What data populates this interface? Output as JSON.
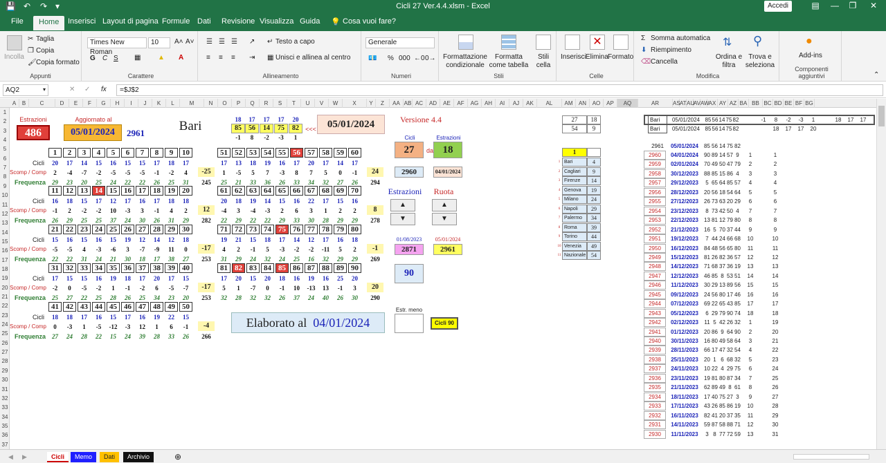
{
  "window": {
    "title": "Cicli 27 Ver.4.4.xlsm  -  Excel",
    "signin": "Accedi"
  },
  "menu_tabs": [
    "File",
    "Home",
    "Inserisci",
    "Layout di pagina",
    "Formule",
    "Dati",
    "Revisione",
    "Visualizza",
    "Guida",
    "Cosa vuoi fare?"
  ],
  "ribbon": {
    "clipboard": {
      "paste": "Incolla",
      "cut": "Taglia",
      "copy": "Copia",
      "format_painter": "Copia formato",
      "label": "Appunti"
    },
    "font": {
      "name": "Times New Roman",
      "size": "10",
      "label": "Carattere",
      "bold": "G",
      "italic": "C",
      "underline": "S"
    },
    "alignment": {
      "wrap": "Testo a capo",
      "merge": "Unisci e allinea al centro",
      "label": "Allineamento"
    },
    "number": {
      "format": "Generale",
      "label": "Numeri"
    },
    "styles": {
      "cond": "Formattazione condizionale",
      "table": "Formatta come tabella",
      "cell": "Stili cella",
      "label": "Stili"
    },
    "cells": {
      "insert": "Inserisci",
      "delete": "Elimina",
      "format": "Formato",
      "label": "Celle"
    },
    "editing": {
      "autosum": "Somma automatica",
      "fill": "Riempimento",
      "clear": "Cancella",
      "sort": "Ordina e filtra",
      "find": "Trova e seleziona",
      "label": "Modifica"
    },
    "addins": {
      "addins": "Add-ins",
      "label": "Componenti aggiuntivi"
    }
  },
  "formula_bar": {
    "name_box": "AQ2",
    "formula": "=$J$2"
  },
  "columns": [
    "A",
    "B",
    "C",
    "D",
    "E",
    "F",
    "G",
    "H",
    "I",
    "J",
    "K",
    "L",
    "M",
    "N",
    "O",
    "P",
    "Q",
    "R",
    "S",
    "T",
    "U",
    "V",
    "W",
    "X",
    "Y",
    "Z",
    "AA",
    "AB",
    "AC",
    "AD",
    "AE",
    "AF",
    "AG",
    "AH",
    "AI",
    "AJ",
    "AK",
    "AL",
    "AM",
    "AN",
    "AO",
    "AP",
    "AQ",
    "AR",
    "AS",
    "AT",
    "AU",
    "AV",
    "AW",
    "AX",
    "AY",
    "AZ",
    "BA",
    "BB",
    "BC",
    "BD",
    "BE",
    "BF",
    "BG"
  ],
  "rows": [
    1,
    2,
    3,
    4,
    5,
    6,
    7,
    8,
    9,
    10,
    11,
    12,
    13,
    14,
    15,
    16,
    17,
    18,
    19,
    20,
    21,
    22,
    23,
    24,
    25,
    26,
    27,
    28,
    29,
    30,
    31,
    32,
    33,
    34,
    35,
    36,
    37
  ],
  "header": {
    "estrazioni_label": "Estrazioni",
    "estrazioni_value": "486",
    "aggiornato_label": "Aggiornato al",
    "aggiornato_date": "05/01/2024",
    "aggiornato_num": "2961",
    "ruota": "Bari",
    "top_cycles": [
      "18",
      "17",
      "17",
      "17",
      "20"
    ],
    "top_numbers": [
      "85",
      "56",
      "14",
      "75",
      "82"
    ],
    "top_arrow": "<<<",
    "top_deltas": [
      "-1",
      "8",
      "-2",
      "-3",
      "1"
    ],
    "top_date": "05/01/2024",
    "version": "Versione 4.4"
  },
  "row_labels": {
    "cicli": "Cicli",
    "scomp": "Scomp / Comp",
    "freq": "Frequenza"
  },
  "blocks_left": [
    {
      "numbers": [
        "1",
        "2",
        "3",
        "4",
        "5",
        "6",
        "7",
        "8",
        "9",
        "10"
      ],
      "red": [],
      "cicli": [
        "20",
        "17",
        "14",
        "15",
        "16",
        "15",
        "15",
        "17",
        "18",
        "17"
      ],
      "scomp": [
        "2",
        "-4",
        "-7",
        "-2",
        "-5",
        "-5",
        "-5",
        "-1",
        "-2",
        "4"
      ],
      "freq": [
        "29",
        "23",
        "20",
        "25",
        "24",
        "22",
        "22",
        "26",
        "25",
        "31"
      ],
      "box": "-25",
      "total": "245"
    },
    {
      "numbers": [
        "11",
        "12",
        "13",
        "14",
        "15",
        "16",
        "17",
        "18",
        "19",
        "20"
      ],
      "red": [
        "14"
      ],
      "cicli": [
        "16",
        "18",
        "15",
        "17",
        "12",
        "17",
        "16",
        "17",
        "18",
        "18"
      ],
      "scomp": [
        "-1",
        "2",
        "-2",
        "-2",
        "10",
        "-3",
        "3",
        "-1",
        "4",
        "2"
      ],
      "freq": [
        "26",
        "29",
        "25",
        "25",
        "37",
        "24",
        "30",
        "26",
        "31",
        "29"
      ],
      "box": "12",
      "total": "282"
    },
    {
      "numbers": [
        "21",
        "22",
        "23",
        "24",
        "25",
        "26",
        "27",
        "28",
        "29",
        "30"
      ],
      "red": [],
      "cicli": [
        "15",
        "16",
        "15",
        "16",
        "15",
        "19",
        "12",
        "14",
        "12",
        "18"
      ],
      "scomp": [
        "-5",
        "-5",
        "4",
        "-3",
        "-6",
        "3",
        "-7",
        "-9",
        "11",
        "0"
      ],
      "freq": [
        "22",
        "22",
        "31",
        "24",
        "21",
        "30",
        "18",
        "17",
        "38",
        "27"
      ],
      "box": "-17",
      "total": "253"
    },
    {
      "numbers": [
        "31",
        "32",
        "33",
        "34",
        "35",
        "36",
        "37",
        "38",
        "39",
        "40"
      ],
      "red": [],
      "cicli": [
        "17",
        "15",
        "15",
        "16",
        "19",
        "18",
        "17",
        "20",
        "17",
        "15"
      ],
      "scomp": [
        "-2",
        "0",
        "-5",
        "-2",
        "1",
        "-1",
        "-2",
        "6",
        "-5",
        "-7"
      ],
      "freq": [
        "25",
        "27",
        "22",
        "25",
        "28",
        "26",
        "25",
        "34",
        "23",
        "20"
      ],
      "box": "-17",
      "total": "253"
    },
    {
      "numbers": [
        "41",
        "42",
        "43",
        "44",
        "45",
        "46",
        "47",
        "48",
        "49",
        "50"
      ],
      "red": [],
      "cicli": [
        "18",
        "18",
        "17",
        "16",
        "15",
        "17",
        "16",
        "19",
        "22",
        "15"
      ],
      "scomp": [
        "0",
        "-3",
        "1",
        "-5",
        "-12",
        "-3",
        "12",
        "1",
        "6",
        "-1"
      ],
      "freq": [
        "27",
        "24",
        "28",
        "22",
        "15",
        "24",
        "39",
        "28",
        "33",
        "26"
      ],
      "box": "-4",
      "total": "266"
    }
  ],
  "blocks_right": [
    {
      "numbers": [
        "51",
        "52",
        "53",
        "54",
        "55",
        "56",
        "57",
        "58",
        "59",
        "60"
      ],
      "red": [
        "56"
      ],
      "cicli": [
        "17",
        "13",
        "18",
        "19",
        "16",
        "17",
        "20",
        "17",
        "14",
        "17"
      ],
      "scomp": [
        "1",
        "-5",
        "5",
        "7",
        "-3",
        "8",
        "7",
        "5",
        "0",
        "-1"
      ],
      "freq": [
        "25",
        "21",
        "33",
        "36",
        "26",
        "33",
        "34",
        "32",
        "27",
        "26"
      ],
      "box": "24",
      "total": "294"
    },
    {
      "numbers": [
        "61",
        "62",
        "63",
        "64",
        "65",
        "66",
        "67",
        "68",
        "69",
        "70"
      ],
      "red": [],
      "cicli": [
        "20",
        "18",
        "19",
        "14",
        "15",
        "16",
        "22",
        "17",
        "15",
        "16"
      ],
      "scomp": [
        "-4",
        "3",
        "-4",
        "-3",
        "2",
        "6",
        "3",
        "1",
        "2",
        "2"
      ],
      "freq": [
        "22",
        "29",
        "22",
        "22",
        "29",
        "33",
        "30",
        "28",
        "29",
        "29"
      ],
      "box": "8",
      "total": "278"
    },
    {
      "numbers": [
        "71",
        "72",
        "73",
        "74",
        "75",
        "76",
        "77",
        "78",
        "79",
        "80"
      ],
      "red": [
        "75"
      ],
      "cicli": [
        "19",
        "21",
        "15",
        "18",
        "17",
        "14",
        "12",
        "17",
        "16",
        "18"
      ],
      "scomp": [
        "4",
        "2",
        "-1",
        "5",
        "-3",
        "-2",
        "-2",
        "-11",
        "5",
        "2"
      ],
      "freq": [
        "31",
        "29",
        "24",
        "32",
        "24",
        "25",
        "16",
        "32",
        "29",
        "29"
      ],
      "box": "-1",
      "total": "269"
    },
    {
      "numbers": [
        "81",
        "82",
        "83",
        "84",
        "85",
        "86",
        "87",
        "88",
        "89",
        "90"
      ],
      "red": [
        "82",
        "85"
      ],
      "cicli": [
        "17",
        "20",
        "15",
        "20",
        "18",
        "16",
        "19",
        "16",
        "25",
        "20"
      ],
      "scomp": [
        "5",
        "1",
        "-7",
        "0",
        "-1",
        "10",
        "-13",
        "13",
        "-1",
        "3"
      ],
      "freq": [
        "32",
        "28",
        "32",
        "32",
        "26",
        "37",
        "24",
        "40",
        "26",
        "30"
      ],
      "box": "20",
      "total": "290"
    }
  ],
  "panel": {
    "cicli_label": "Cicli",
    "cicli_value": "27",
    "da": "da",
    "estr_label": "Estrazioni",
    "estr_value": "18",
    "value2960": "2960",
    "date2": "04/01/2024",
    "estrazioni_btn": "Estrazioni",
    "ruota_btn": "Ruota",
    "date_a": "01/08/2023",
    "date_b": "05/01/2024",
    "val_a": "2871",
    "val_b": "2961",
    "ninety": "90",
    "estr_meno": "Estr. meno",
    "cicli90": "Cicli 90",
    "elaborato_label": "Elaborato al",
    "elaborato_date": "04/01/2024"
  },
  "al_top": [
    [
      "27",
      "18"
    ],
    [
      "54",
      "9"
    ]
  ],
  "ruote_highlight": "1",
  "ruote": [
    {
      "n": "1",
      "name": "Bari",
      "v": "4"
    },
    {
      "n": "2",
      "name": "Cagliari",
      "v": "9"
    },
    {
      "n": "3",
      "name": "Firenze",
      "v": "14"
    },
    {
      "n": "4",
      "name": "Genova",
      "v": "19"
    },
    {
      "n": "5",
      "name": "Milano",
      "v": "24"
    },
    {
      "n": "6",
      "name": "Napoli",
      "v": "29"
    },
    {
      "n": "7",
      "name": "Palermo",
      "v": "34"
    },
    {
      "n": "8",
      "name": "Roma",
      "v": "39"
    },
    {
      "n": "9",
      "name": "Torino",
      "v": "44"
    },
    {
      "n": "10",
      "name": "Venezia",
      "v": "49"
    },
    {
      "n": "11",
      "name": "Nazionale",
      "v": "54"
    }
  ],
  "right_top": [
    {
      "city": "Bari",
      "date": "05/01/2024",
      "nums": [
        "85",
        "56",
        "14",
        "75",
        "82"
      ],
      "extra": [
        "-1",
        "8",
        "-2",
        "-3",
        "1",
        "",
        "18",
        "17",
        "17"
      ]
    },
    {
      "city": "Bari",
      "date": "05/01/2024",
      "nums": [
        "85",
        "56",
        "14",
        "75",
        "82"
      ],
      "extra": [
        "",
        "18",
        "17",
        "17",
        "20"
      ]
    }
  ],
  "draws_header": {
    "id": "2961",
    "date": "05/01/2024",
    "nums": [
      "85",
      "56",
      "14",
      "75",
      "82"
    ]
  },
  "draws": [
    {
      "id": "2960",
      "date": "04/01/2024",
      "nums": [
        "90",
        "89",
        "14",
        "57",
        "9"
      ],
      "a": "1",
      "b": "1"
    },
    {
      "id": "2959",
      "date": "02/01/2024",
      "nums": [
        "70",
        "49",
        "50",
        "47",
        "79"
      ],
      "a": "2",
      "b": "2"
    },
    {
      "id": "2958",
      "date": "30/12/2023",
      "nums": [
        "88",
        "85",
        "15",
        "86",
        "4"
      ],
      "a": "3",
      "b": "3"
    },
    {
      "id": "2957",
      "date": "29/12/2023",
      "nums": [
        "5",
        "65",
        "64",
        "85",
        "57"
      ],
      "a": "4",
      "b": "4"
    },
    {
      "id": "2956",
      "date": "28/12/2023",
      "nums": [
        "20",
        "56",
        "18",
        "54",
        "64"
      ],
      "a": "5",
      "b": "5"
    },
    {
      "id": "2955",
      "date": "27/12/2023",
      "nums": [
        "26",
        "73",
        "63",
        "20",
        "29"
      ],
      "a": "6",
      "b": "6"
    },
    {
      "id": "2954",
      "date": "23/12/2023",
      "nums": [
        "8",
        "73",
        "42",
        "50",
        "4"
      ],
      "a": "7",
      "b": "7"
    },
    {
      "id": "2953",
      "date": "22/12/2023",
      "nums": [
        "13",
        "81",
        "12",
        "79",
        "80"
      ],
      "a": "8",
      "b": "8"
    },
    {
      "id": "2952",
      "date": "21/12/2023",
      "nums": [
        "16",
        "5",
        "70",
        "37",
        "44"
      ],
      "a": "9",
      "b": "9"
    },
    {
      "id": "2951",
      "date": "19/12/2023",
      "nums": [
        "7",
        "44",
        "24",
        "66",
        "68"
      ],
      "a": "10",
      "b": "10"
    },
    {
      "id": "2950",
      "date": "16/12/2023",
      "nums": [
        "84",
        "48",
        "56",
        "65",
        "80"
      ],
      "a": "11",
      "b": "11"
    },
    {
      "id": "2949",
      "date": "15/12/2023",
      "nums": [
        "81",
        "26",
        "82",
        "36",
        "57"
      ],
      "a": "12",
      "b": "12"
    },
    {
      "id": "2948",
      "date": "14/12/2023",
      "nums": [
        "71",
        "68",
        "37",
        "36",
        "19"
      ],
      "a": "13",
      "b": "13"
    },
    {
      "id": "2947",
      "date": "12/12/2023",
      "nums": [
        "46",
        "85",
        "8",
        "53",
        "51"
      ],
      "a": "14",
      "b": "14"
    },
    {
      "id": "2946",
      "date": "11/12/2023",
      "nums": [
        "30",
        "29",
        "13",
        "89",
        "56"
      ],
      "a": "15",
      "b": "15"
    },
    {
      "id": "2945",
      "date": "09/12/2023",
      "nums": [
        "24",
        "56",
        "80",
        "17",
        "46"
      ],
      "a": "16",
      "b": "16"
    },
    {
      "id": "2944",
      "date": "07/12/2023",
      "nums": [
        "69",
        "22",
        "65",
        "43",
        "85"
      ],
      "a": "17",
      "b": "17"
    },
    {
      "id": "2943",
      "date": "05/12/2023",
      "nums": [
        "6",
        "29",
        "79",
        "90",
        "74"
      ],
      "a": "18",
      "b": "18"
    },
    {
      "id": "2942",
      "date": "02/12/2023",
      "nums": [
        "11",
        "5",
        "42",
        "26",
        "32"
      ],
      "a": "1",
      "b": "19"
    },
    {
      "id": "2941",
      "date": "01/12/2023",
      "nums": [
        "20",
        "86",
        "9",
        "64",
        "90"
      ],
      "a": "2",
      "b": "20"
    },
    {
      "id": "2940",
      "date": "30/11/2023",
      "nums": [
        "16",
        "80",
        "49",
        "58",
        "64"
      ],
      "a": "3",
      "b": "21"
    },
    {
      "id": "2939",
      "date": "28/11/2023",
      "nums": [
        "66",
        "17",
        "47",
        "32",
        "54"
      ],
      "a": "4",
      "b": "22"
    },
    {
      "id": "2938",
      "date": "25/11/2023",
      "nums": [
        "20",
        "1",
        "6",
        "68",
        "32"
      ],
      "a": "5",
      "b": "23"
    },
    {
      "id": "2937",
      "date": "24/11/2023",
      "nums": [
        "10",
        "22",
        "4",
        "29",
        "75"
      ],
      "a": "6",
      "b": "24"
    },
    {
      "id": "2936",
      "date": "23/11/2023",
      "nums": [
        "19",
        "81",
        "80",
        "87",
        "34"
      ],
      "a": "7",
      "b": "25"
    },
    {
      "id": "2935",
      "date": "21/11/2023",
      "nums": [
        "62",
        "89",
        "49",
        "8",
        "61"
      ],
      "a": "8",
      "b": "26"
    },
    {
      "id": "2934",
      "date": "18/11/2023",
      "nums": [
        "17",
        "40",
        "75",
        "27",
        "3"
      ],
      "a": "9",
      "b": "27"
    },
    {
      "id": "2933",
      "date": "17/11/2023",
      "nums": [
        "43",
        "26",
        "85",
        "86",
        "19"
      ],
      "a": "10",
      "b": "28"
    },
    {
      "id": "2932",
      "date": "16/11/2023",
      "nums": [
        "82",
        "41",
        "20",
        "37",
        "35"
      ],
      "a": "11",
      "b": "29"
    },
    {
      "id": "2931",
      "date": "14/11/2023",
      "nums": [
        "59",
        "87",
        "58",
        "88",
        "71"
      ],
      "a": "12",
      "b": "30"
    },
    {
      "id": "2930",
      "date": "11/11/2023",
      "nums": [
        "3",
        "8",
        "77",
        "72",
        "59"
      ],
      "a": "13",
      "b": "31"
    }
  ],
  "sheet_tabs": [
    "Cicli",
    "Memo",
    "Dati",
    "Archivio"
  ]
}
